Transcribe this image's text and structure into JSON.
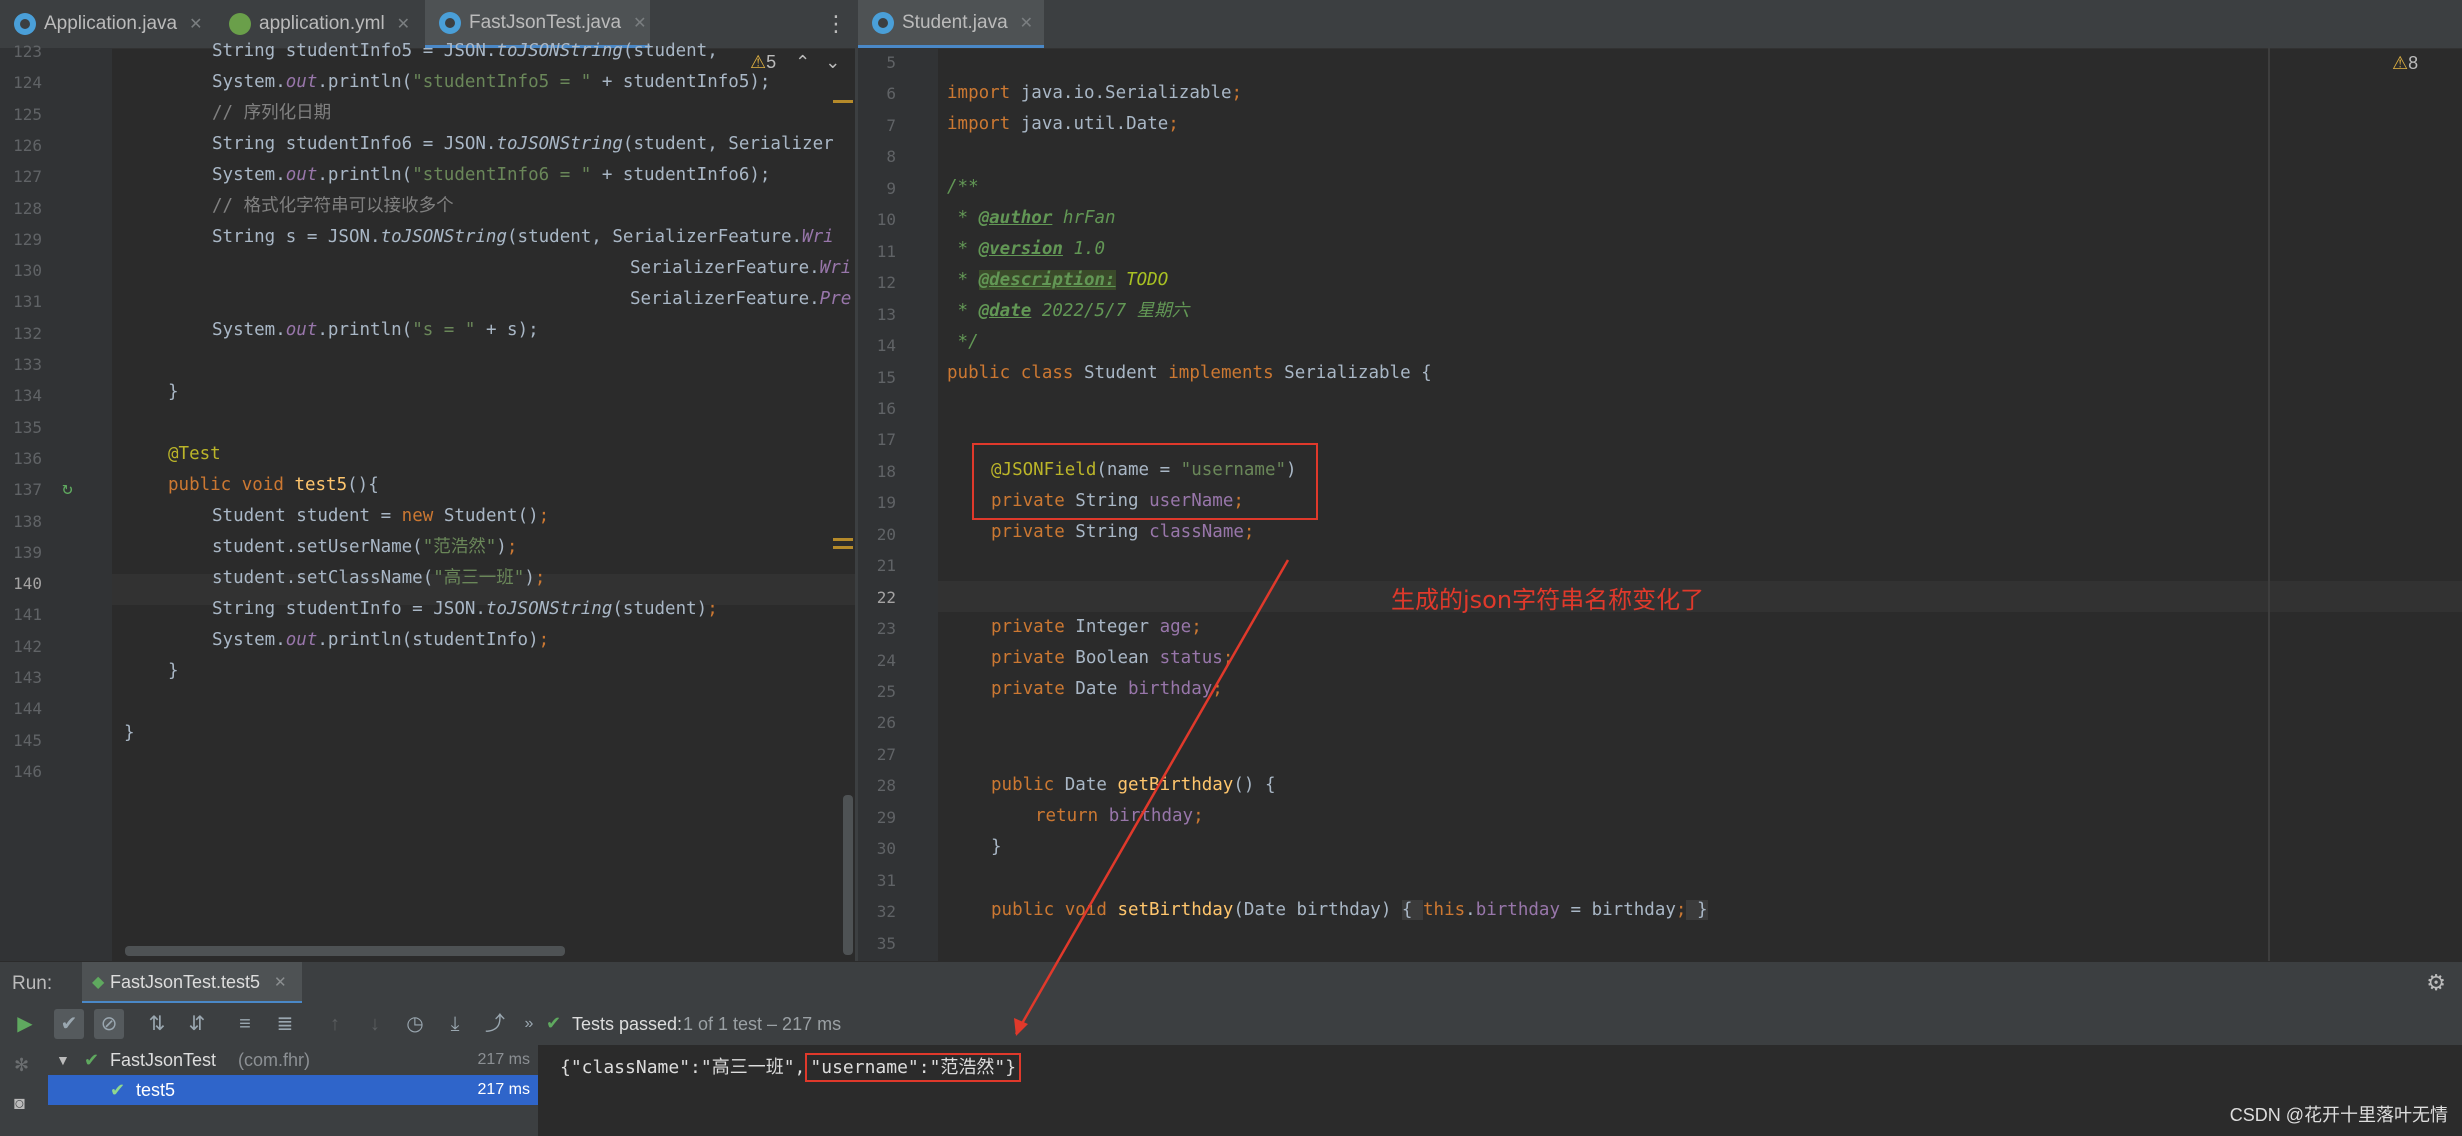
{
  "tabs_left": [
    {
      "label": "Application.java",
      "icon": "java-class-icon"
    },
    {
      "label": "application.yml",
      "icon": "yaml-file-icon"
    },
    {
      "label": "FastJsonTest.java",
      "icon": "test-class-icon",
      "active": true
    }
  ],
  "tabs_right": [
    {
      "label": "Student.java",
      "icon": "java-class-icon",
      "active": true
    }
  ],
  "left_editor": {
    "warnings": "5",
    "line_numbers": [
      "123",
      "124",
      "125",
      "126",
      "127",
      "128",
      "129",
      "130",
      "131",
      "132",
      "133",
      "134",
      "135",
      "136",
      "137",
      "138",
      "139",
      "140",
      "141",
      "142",
      "143",
      "144",
      "145",
      "146"
    ],
    "current_line": "140"
  },
  "right_editor": {
    "warnings": "8",
    "line_numbers": [
      "5",
      "6",
      "7",
      "8",
      "9",
      "10",
      "11",
      "12",
      "13",
      "14",
      "15",
      "16",
      "17",
      "18",
      "19",
      "20",
      "21",
      "22",
      "23",
      "24",
      "25",
      "26",
      "27",
      "28",
      "29",
      "30",
      "31",
      "32",
      "35"
    ],
    "current_line": "22"
  },
  "annotation": {
    "text": "生成的json字符串名称变化了",
    "color": "#e0392b"
  },
  "run": {
    "label": "Run:",
    "config_tab": "FastJsonTest.test5",
    "status_passed": "Tests passed:",
    "status_count": "1 of 1 test – 217 ms",
    "tree": [
      {
        "label": "FastJsonTest",
        "pkg": "(com.fhr)",
        "time": "217 ms"
      },
      {
        "label": "test5",
        "pkg": "",
        "time": "217 ms"
      }
    ],
    "console_part1": "{\"className\":\"高三一班\",",
    "console_part2": "\"username\":\"范浩然\"}"
  },
  "watermark": "CSDN @花开十里落叶无情"
}
